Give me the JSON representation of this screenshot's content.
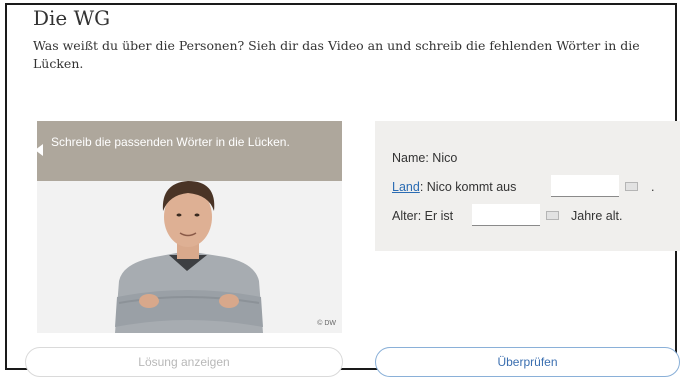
{
  "exercise": {
    "title": "Die WG",
    "instructions": "Was weißt du über die Personen? Sieh dir das Video an und schreib die fehlenden Wörter in die Lücken."
  },
  "image_card": {
    "banner_text": "Schreib die passenden Wörter in die Lücken.",
    "credit": "© DW"
  },
  "gap_fill": {
    "name_line": "Name: Nico",
    "land_link": "Land",
    "land_text": ": Nico kommt aus",
    "land_value": "",
    "land_end": ".",
    "alter_prefix": "Alter: Er ist",
    "alter_value": "",
    "alter_suffix": "Jahre alt."
  },
  "buttons": {
    "solution_label": "Lösung anzeigen",
    "check_label": "Überprüfen"
  },
  "icons": {
    "gap_keyboard": "keyboard-icon",
    "speech_tail": "speech-bubble-tail"
  },
  "colors": {
    "banner": "#aea79c",
    "panel": "#f0efed",
    "link": "#2b6cb3",
    "check_border": "#8ab0d8"
  }
}
